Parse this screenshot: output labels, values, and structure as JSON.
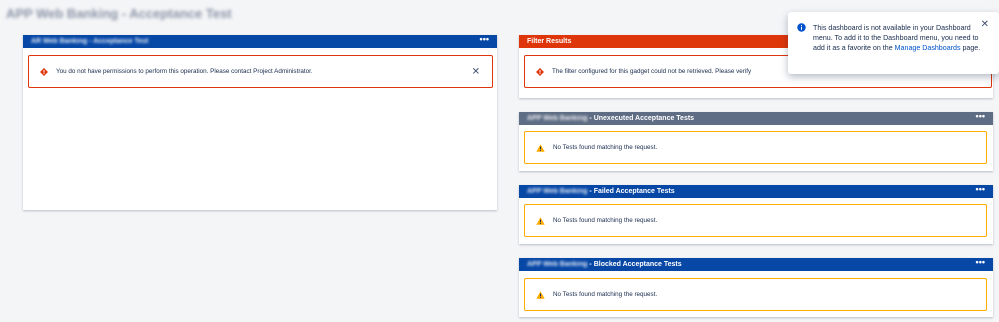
{
  "page": {
    "title": "APP Web Banking - Acceptance Test"
  },
  "left_gadget": {
    "title": "AR Web Banking - Acceptance Test",
    "menu": "•••",
    "error": "You do not have permissions to perform this operation. Please contact Project Administrator.",
    "close": "✕"
  },
  "filter_gadget": {
    "title": "Filter Results",
    "menu": "•••",
    "error": "The filter configured for this gadget could not be retrieved. Please verify"
  },
  "test_gadgets": [
    {
      "prefix": "APP Web Banking",
      "title": "- Unexecuted Acceptance Tests",
      "menu": "•••",
      "message": "No Tests found matching the request."
    },
    {
      "prefix": "APP Web Banking",
      "title": "- Failed Acceptance Tests",
      "menu": "•••",
      "message": "No Tests found matching the request."
    },
    {
      "prefix": "APP Web Banking",
      "title": "- Blocked Acceptance Tests",
      "menu": "•••",
      "message": "No Tests found matching the request."
    }
  ],
  "flag": {
    "text_before": "This dashboard is not available in your Dashboard menu. To add it to the Dashboard menu, you need to add it as a favorite on the ",
    "link": "Manage Dashboards",
    "text_after": " page.",
    "close": "✕"
  },
  "colors": {
    "blue_header": "#0747a6",
    "red_header": "#de350b",
    "grey_header": "#5e6c84",
    "error": "#de350b",
    "warning": "#ffab00",
    "link": "#0052cc"
  },
  "icons": {
    "error": "error-diamond-icon",
    "warning": "warning-triangle-icon",
    "info": "info-circle-icon",
    "close": "close-icon",
    "menu": "more-dots-icon"
  }
}
